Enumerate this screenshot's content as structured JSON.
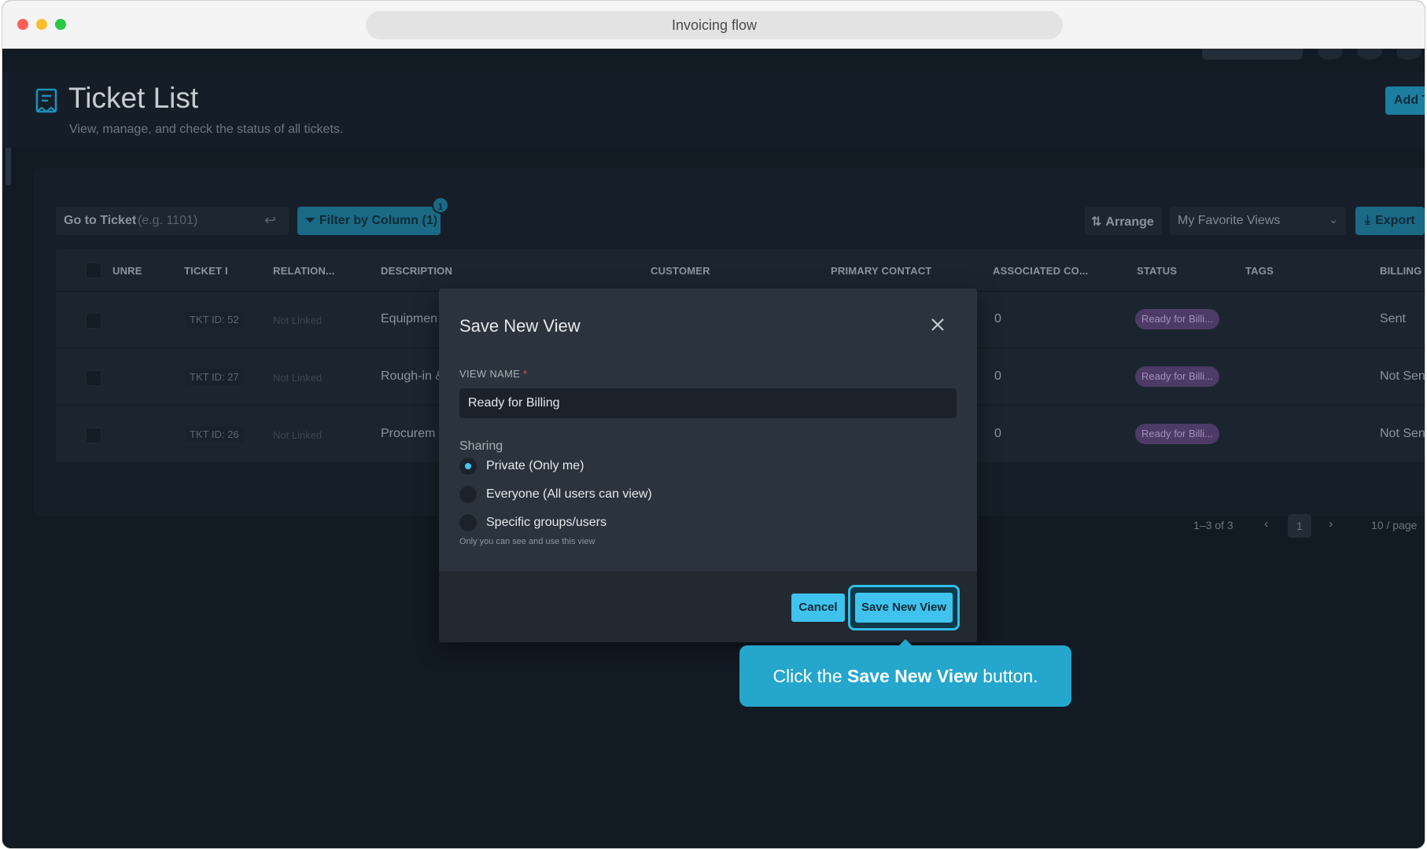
{
  "browser": {
    "url_title": "Invoicing flow"
  },
  "page": {
    "title": "Ticket List",
    "subtitle": "View, manage, and check the status of all tickets.",
    "add_button": "Add T"
  },
  "toolbar": {
    "goto_label": "Go to Ticket",
    "goto_placeholder": "(e.g. 1101)",
    "filter_label": "Filter by Column (1)",
    "filter_badge": "1",
    "arrange_label": "Arrange",
    "views_value": "My Favorite Views",
    "export_label": "Export"
  },
  "table": {
    "columns": [
      "UNRE",
      "TICKET I",
      "RELATION...",
      "DESCRIPTION",
      "CUSTOMER",
      "PRIMARY CONTACT",
      "ASSOCIATED CO...",
      "STATUS",
      "TAGS",
      "BILLING S"
    ],
    "rows": [
      {
        "ticket": "TKT ID: 52",
        "relation": "Not Linked",
        "description": "Equipmen",
        "associated": "0",
        "status": "Ready for Billi...",
        "billing": "Sent"
      },
      {
        "ticket": "TKT ID: 27",
        "relation": "Not Linked",
        "description": "Rough-in &",
        "associated": "0",
        "status": "Ready for Billi...",
        "billing": "Not Sent"
      },
      {
        "ticket": "TKT ID: 26",
        "relation": "Not Linked",
        "description": "Procurem",
        "associated": "0",
        "status": "Ready for Billi...",
        "billing": "Not Sent"
      }
    ]
  },
  "pagination": {
    "range": "1–3 of 3",
    "page": "1",
    "per_page": "10 / page"
  },
  "modal": {
    "title": "Save New View",
    "field_label": "VIEW NAME",
    "required_mark": "*",
    "name_value": "Ready for Billing",
    "sharing_label": "Sharing",
    "options": [
      {
        "label": "Private (Only me)",
        "checked": true
      },
      {
        "label": "Everyone (All users can view)",
        "checked": false
      },
      {
        "label": "Specific groups/users",
        "checked": false
      }
    ],
    "hint": "Only you can see and use this view",
    "cancel_label": "Cancel",
    "save_label": "Save New View"
  },
  "tooltip": {
    "prefix": "Click the",
    "bold": "Save New View",
    "suffix": "button."
  },
  "colors": {
    "accent": "#3fc3ee",
    "tooltip": "#25a6cc",
    "status_pill": "#4d3a66",
    "background": "#121a23"
  }
}
